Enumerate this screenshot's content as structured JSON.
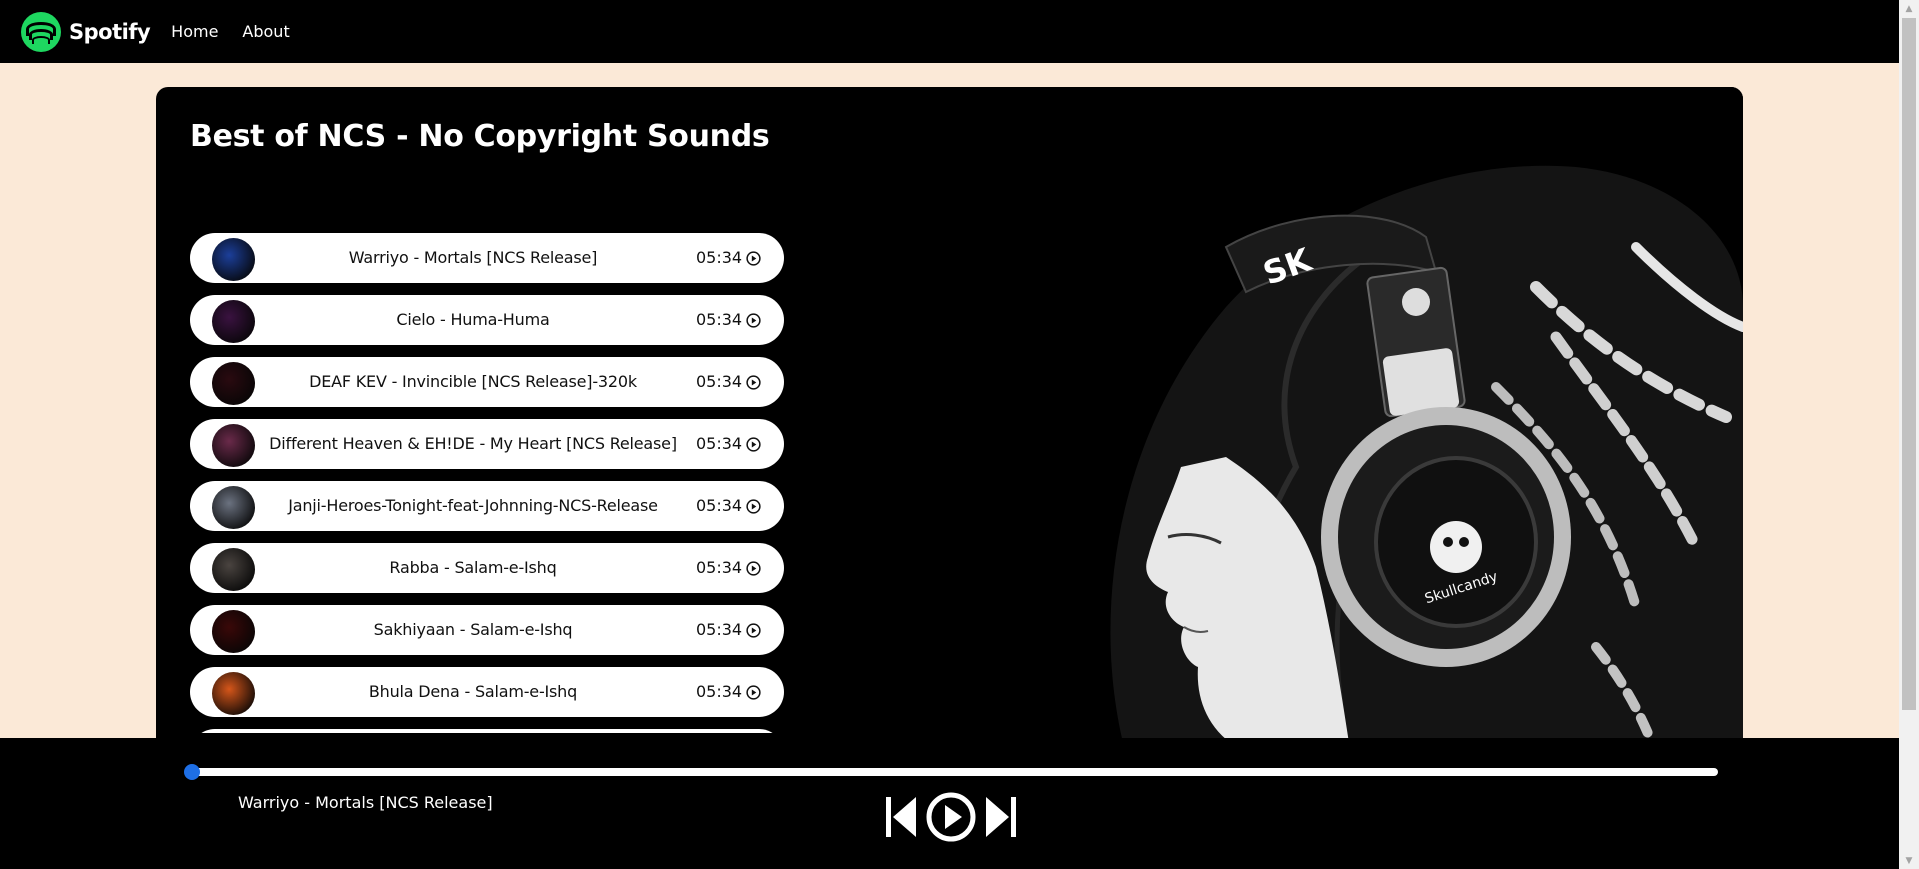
{
  "nav": {
    "brand": "Spotify",
    "links": [
      "Home",
      "About"
    ]
  },
  "playlist": {
    "title": "Best of NCS - No Copyright Sounds"
  },
  "songs": [
    {
      "name": "Warriyo - Mortals [NCS Release]",
      "duration": "05:34",
      "cover_color": "#1c3f9a"
    },
    {
      "name": "Cielo - Huma-Huma",
      "duration": "05:34",
      "cover_color": "#3a1240"
    },
    {
      "name": "DEAF KEV - Invincible [NCS Release]-320k",
      "duration": "05:34",
      "cover_color": "#2a0a10"
    },
    {
      "name": "Different Heaven & EH!DE - My Heart [NCS Release]",
      "duration": "05:34",
      "cover_color": "#6a2a4a"
    },
    {
      "name": "Janji-Heroes-Tonight-feat-Johnning-NCS-Release",
      "duration": "05:34",
      "cover_color": "#6b7280"
    },
    {
      "name": "Rabba - Salam-e-Ishq",
      "duration": "05:34",
      "cover_color": "#4a4440"
    },
    {
      "name": "Sakhiyaan - Salam-e-Ishq",
      "duration": "05:34",
      "cover_color": "#3a0808"
    },
    {
      "name": "Bhula Dena - Salam-e-Ishq",
      "duration": "05:34",
      "cover_color": "#d5561a"
    },
    {
      "name": "",
      "duration": "",
      "cover_color": "#c8802a"
    }
  ],
  "player": {
    "now_playing": "Warriyo - Mortals [NCS Release]",
    "progress": 0
  },
  "colors": {
    "page_background": "#fbe9d7",
    "accent_green": "#1ed760",
    "progress_knob": "#1e6fe6"
  }
}
